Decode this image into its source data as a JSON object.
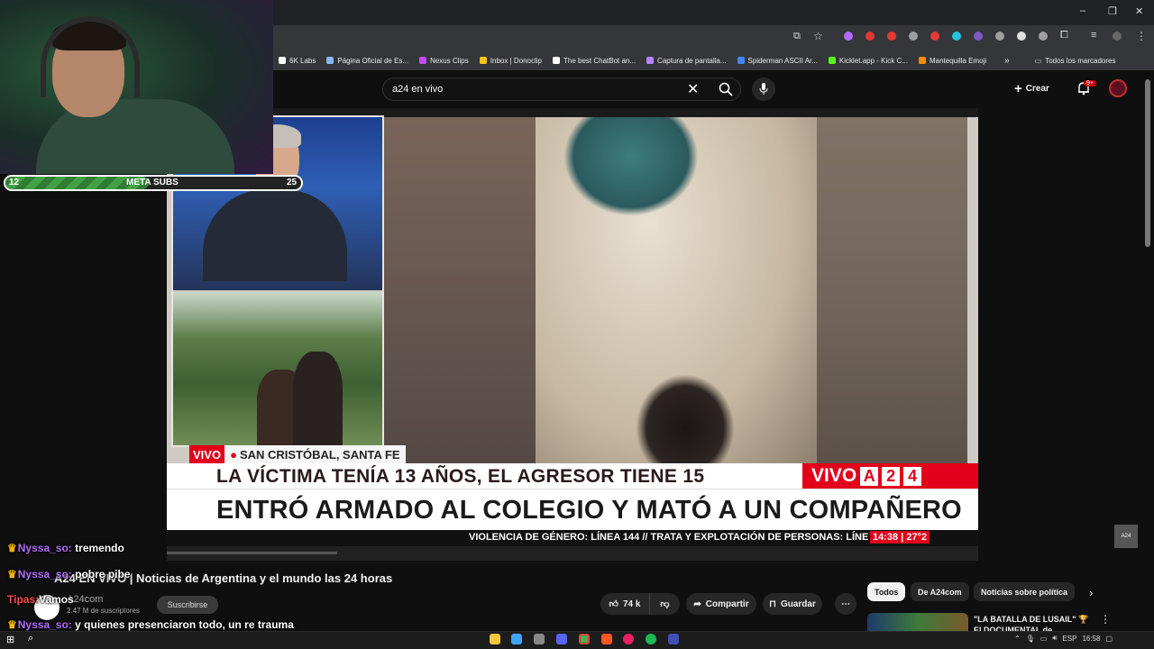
{
  "browser": {
    "window_controls": [
      "–",
      "❐",
      "✕"
    ],
    "bookmarks": [
      {
        "label": "6K Labs",
        "color": "#ffffff"
      },
      {
        "label": "Página Oficial de Es...",
        "color": "#8ab4f8"
      },
      {
        "label": "Nexus Clips",
        "color": "#c44cff"
      },
      {
        "label": "Inbox | Donoclip",
        "color": "#f5c518"
      },
      {
        "label": "The best ChatBot an...",
        "color": "#ffffff"
      },
      {
        "label": "Captura de pantalla...",
        "color": "#b388ff"
      },
      {
        "label": "Spiderman ASCII Ar...",
        "color": "#4285f4"
      },
      {
        "label": "Kicklet.app - Kick C...",
        "color": "#53fc18"
      },
      {
        "label": "Mantequilla Emoji",
        "color": "#ff8a00"
      }
    ],
    "bookmarks_overflow": "»",
    "all_bookmarks": "Todos los marcadores"
  },
  "youtube": {
    "search_value": "a24 en vivo",
    "create_label": "Crear",
    "notifications_badge": "9+"
  },
  "video": {
    "live_tag": "VIVO",
    "location": "SAN CRISTÓBAL, SANTA FE",
    "headline_top": "LA VÍCTIMA TENÍA 13 AÑOS, EL AGRESOR TIENE 15",
    "headline_main": "ENTRÓ ARMADO AL COLEGIO Y MATÓ A UN COMPAÑERO",
    "logo_vivo": "VIVO",
    "logo_letters": [
      "A",
      "2",
      "4"
    ],
    "ticker": "VIOLENCIA DE GÉNERO: LÍNEA 144 // TRATA Y EXPLOTACIÓN DE PERSONAS: LÍNE",
    "ticker_time": "14:38 | 27°2",
    "side_logo": "A24",
    "progress_fraction": 0.21
  },
  "webcam": {
    "sub_goal_min": "12",
    "sub_goal_label": "META SUBS",
    "sub_goal_max": "25",
    "progress_fraction": 0.48
  },
  "watch": {
    "title": "A24 EN VIVO | Noticias de Argentina y el mundo las 24 horas",
    "channel": "A24com",
    "subscribers": "2.47 M de suscriptores",
    "subscribe_label": "Suscribirse",
    "likes": "74 k",
    "share_label": "Compartir",
    "save_label": "Guardar",
    "more_label": "⋯"
  },
  "chips": {
    "all": "Todos",
    "channel": "De A24com",
    "politics": "Noticias sobre política",
    "next": "›"
  },
  "recommended": {
    "title": "\"LA BATALLA DE LUSAIL\" 🏆 El DOCUMENTAL de ARGENTINA"
  },
  "chat": [
    {
      "user": "Nyssa_so:",
      "message": " tremendo",
      "crown": true
    },
    {
      "user": "Nyssa_so:",
      "message": " pobre pibe",
      "crown": true
    },
    {
      "user": "Tipas:",
      "message": "Vamos",
      "crown": false
    },
    {
      "user": "Nyssa_so:",
      "message": " y quienes presenciaron todo, un re trauma",
      "crown": true
    }
  ],
  "taskbar": {
    "language": "ESP",
    "clock": "16:58"
  }
}
